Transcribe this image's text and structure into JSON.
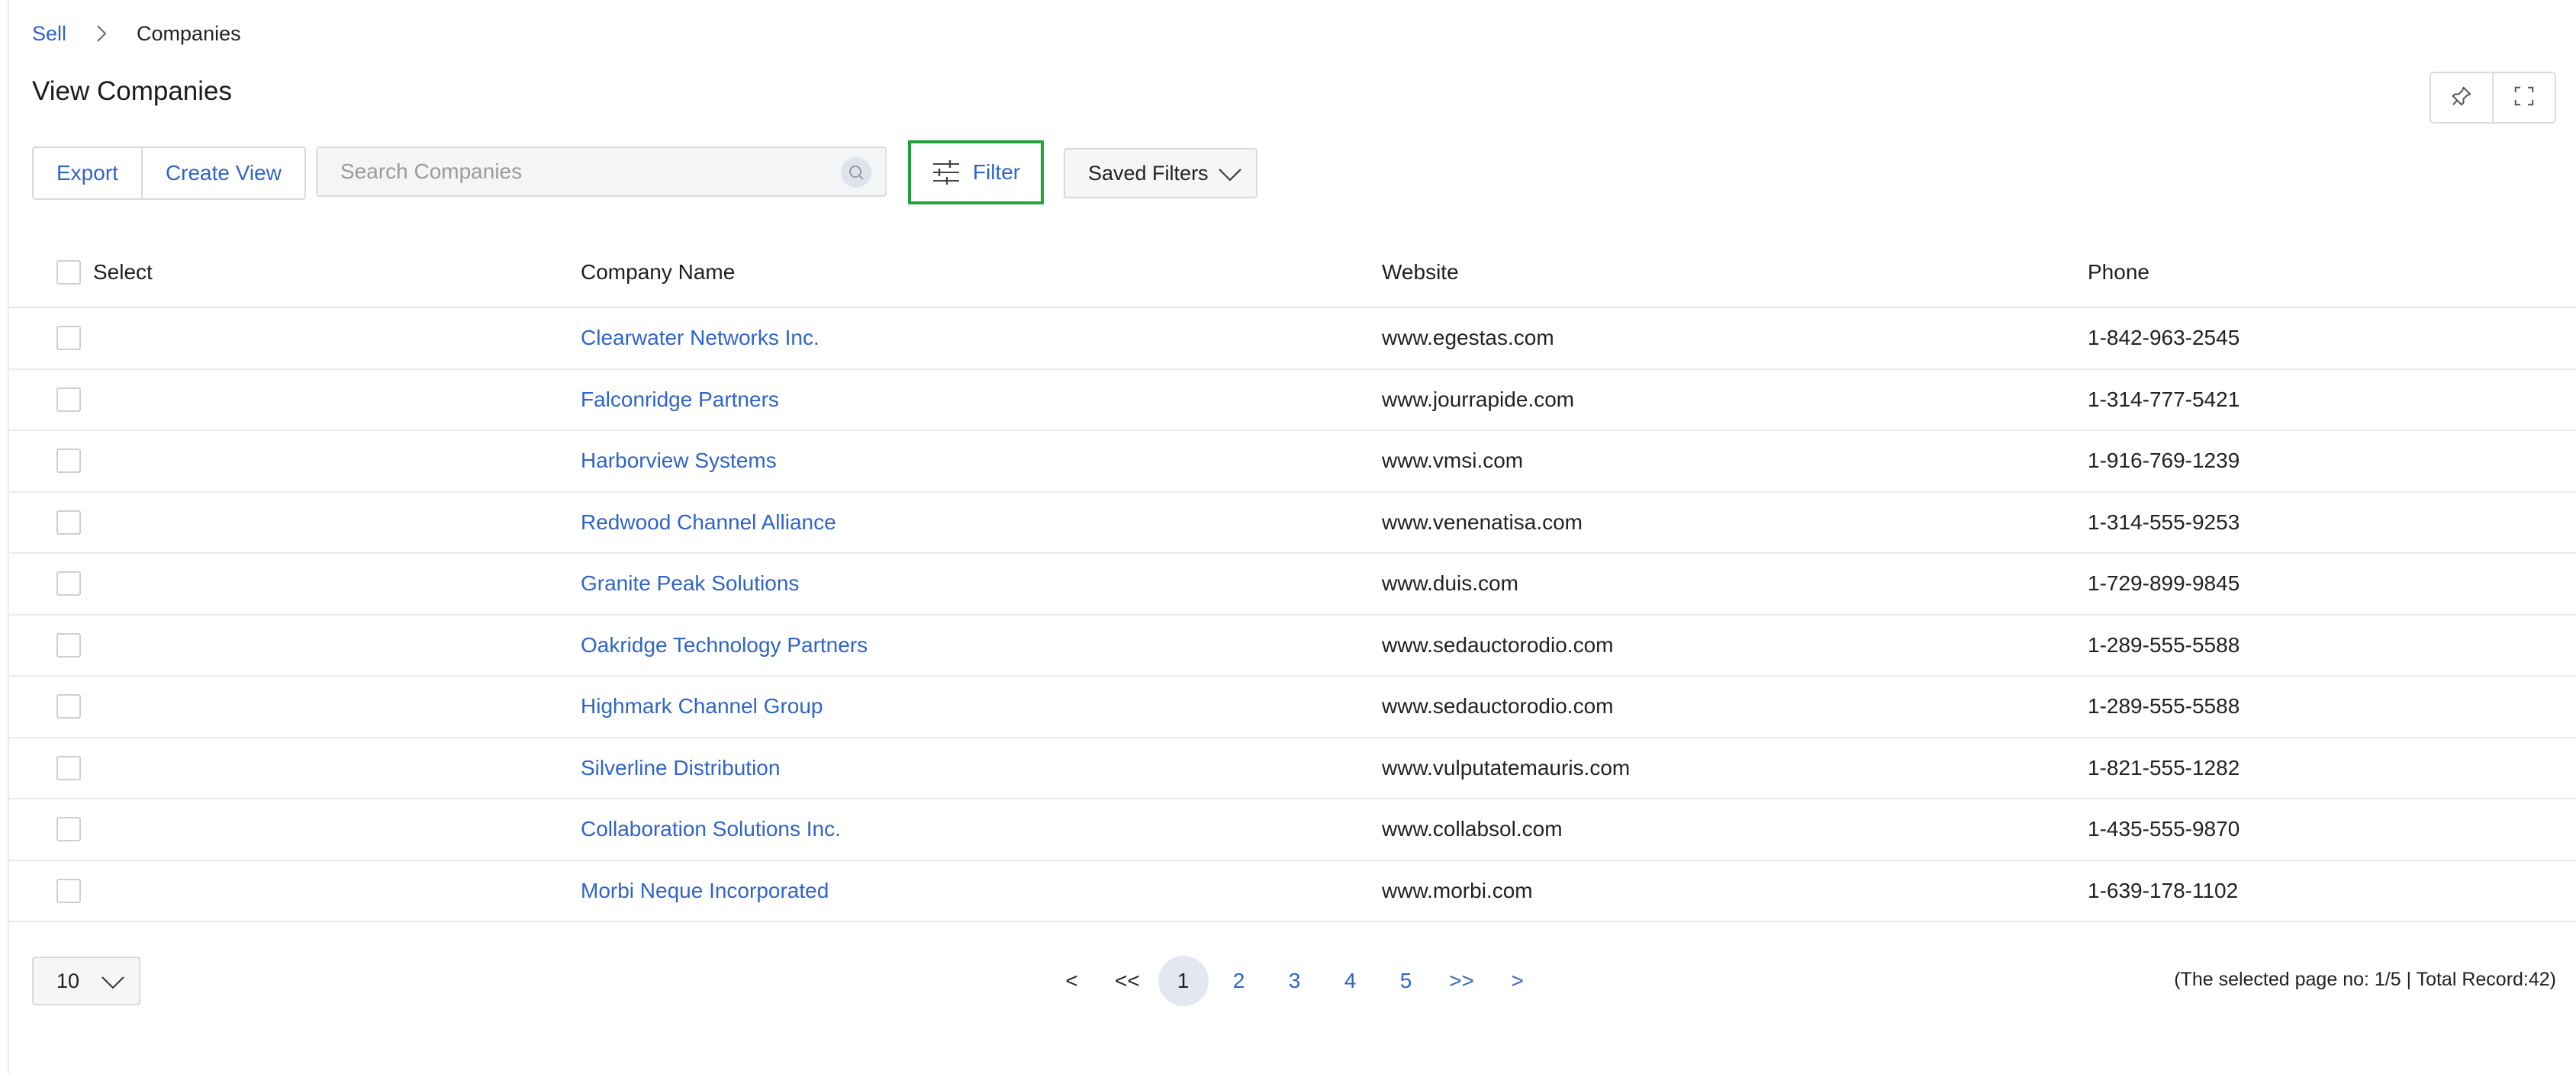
{
  "breadcrumb": {
    "parent": "Sell",
    "current": "Companies"
  },
  "page": {
    "title": "View Companies"
  },
  "toolbar": {
    "export_label": "Export",
    "create_view_label": "Create View",
    "search_placeholder": "Search Companies",
    "filter_label": "Filter",
    "saved_filters_label": "Saved Filters"
  },
  "table": {
    "headers": {
      "select": "Select",
      "company": "Company Name",
      "website": "Website",
      "phone": "Phone"
    },
    "rows": [
      {
        "company": "Clearwater Networks Inc.",
        "website": "www.egestas.com",
        "phone": "1-842-963-2545"
      },
      {
        "company": "Falconridge Partners",
        "website": "www.jourrapide.com",
        "phone": "1-314-777-5421"
      },
      {
        "company": "Harborview Systems",
        "website": "www.vmsi.com",
        "phone": "1-916-769-1239"
      },
      {
        "company": "Redwood Channel Alliance",
        "website": "www.venenatisa.com",
        "phone": "1-314-555-9253"
      },
      {
        "company": "Granite Peak Solutions",
        "website": "www.duis.com",
        "phone": "1-729-899-9845"
      },
      {
        "company": "Oakridge Technology Partners",
        "website": "www.sedauctorodio.com",
        "phone": "1-289-555-5588"
      },
      {
        "company": "Highmark Channel Group",
        "website": "www.sedauctorodio.com",
        "phone": "1-289-555-5588"
      },
      {
        "company": "Silverline Distribution",
        "website": "www.vulputatemauris.com",
        "phone": "1-821-555-1282"
      },
      {
        "company": "Collaboration Solutions Inc.",
        "website": "www.collabsol.com",
        "phone": "1-435-555-9870"
      },
      {
        "company": "Morbi Neque Incorporated",
        "website": "www.morbi.com",
        "phone": "1-639-178-1102"
      }
    ]
  },
  "pagination": {
    "page_size": "10",
    "prev": "<",
    "first": "<<",
    "pages": [
      "1",
      "2",
      "3",
      "4",
      "5"
    ],
    "active_page": "1",
    "last": ">>",
    "next": ">",
    "info": "(The selected page no: 1/5 | Total Record:42)"
  },
  "colors": {
    "link": "#2f64c8",
    "filter_highlight": "#22a33c",
    "active_page_bg": "#e3e8f0"
  },
  "icons": [
    "chevron-right-icon",
    "pin-icon",
    "fullscreen-icon",
    "search-icon",
    "sliders-icon",
    "chevron-down-icon"
  ]
}
